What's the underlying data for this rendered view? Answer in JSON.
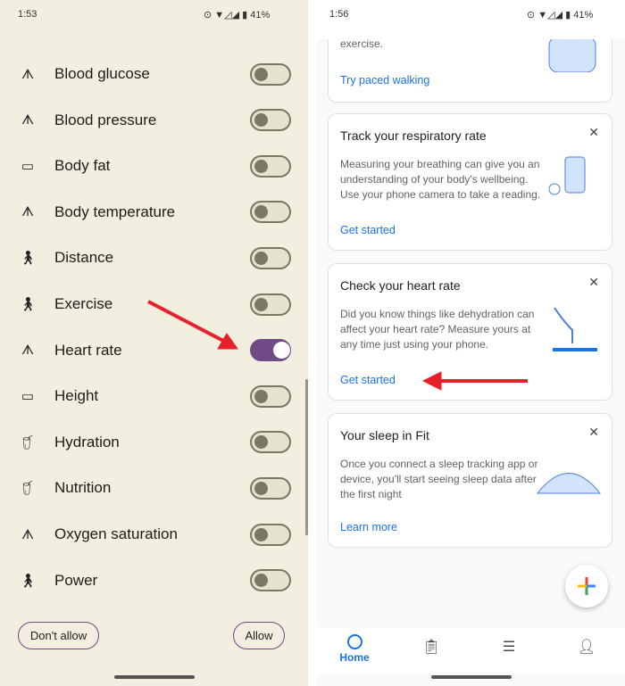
{
  "left": {
    "status": {
      "time": "1:53",
      "battery": "41%"
    },
    "items": [
      {
        "label": "Blood glucose",
        "icon": "vitals-icon",
        "on": false
      },
      {
        "label": "Blood pressure",
        "icon": "vitals-icon",
        "on": false
      },
      {
        "label": "Body fat",
        "icon": "ruler-icon",
        "on": false
      },
      {
        "label": "Body temperature",
        "icon": "vitals-icon",
        "on": false
      },
      {
        "label": "Distance",
        "icon": "walk-icon",
        "on": false
      },
      {
        "label": "Exercise",
        "icon": "walk-icon",
        "on": false
      },
      {
        "label": "Heart rate",
        "icon": "vitals-icon",
        "on": true
      },
      {
        "label": "Height",
        "icon": "ruler-icon",
        "on": false
      },
      {
        "label": "Hydration",
        "icon": "food-icon",
        "on": false
      },
      {
        "label": "Nutrition",
        "icon": "food-icon",
        "on": false
      },
      {
        "label": "Oxygen saturation",
        "icon": "vitals-icon",
        "on": false
      },
      {
        "label": "Power",
        "icon": "walk-icon",
        "on": false
      }
    ],
    "dont_allow": "Don't allow",
    "allow": "Allow"
  },
  "right": {
    "status": {
      "time": "1:56",
      "battery": "41%"
    },
    "cards": [
      {
        "title": "",
        "body": "exercise.",
        "link": "Try paced walking"
      },
      {
        "title": "Track your respiratory rate",
        "body": "Measuring your breathing can give you an understanding of your body's wellbeing. Use your phone camera to take a reading.",
        "link": "Get started"
      },
      {
        "title": "Check your heart rate",
        "body": "Did you know things like dehydration can affect your heart rate? Measure yours at any time just using your phone.",
        "link": "Get started"
      },
      {
        "title": "Your sleep in Fit",
        "body": "Once you connect a sleep tracking app or device, you'll start seeing sleep data after the first night",
        "link": "Learn more"
      }
    ],
    "nav": {
      "home": "Home"
    }
  },
  "colors": {
    "accent": "#6f4a86",
    "link": "#1a73e8",
    "arrow": "#e8202a"
  }
}
